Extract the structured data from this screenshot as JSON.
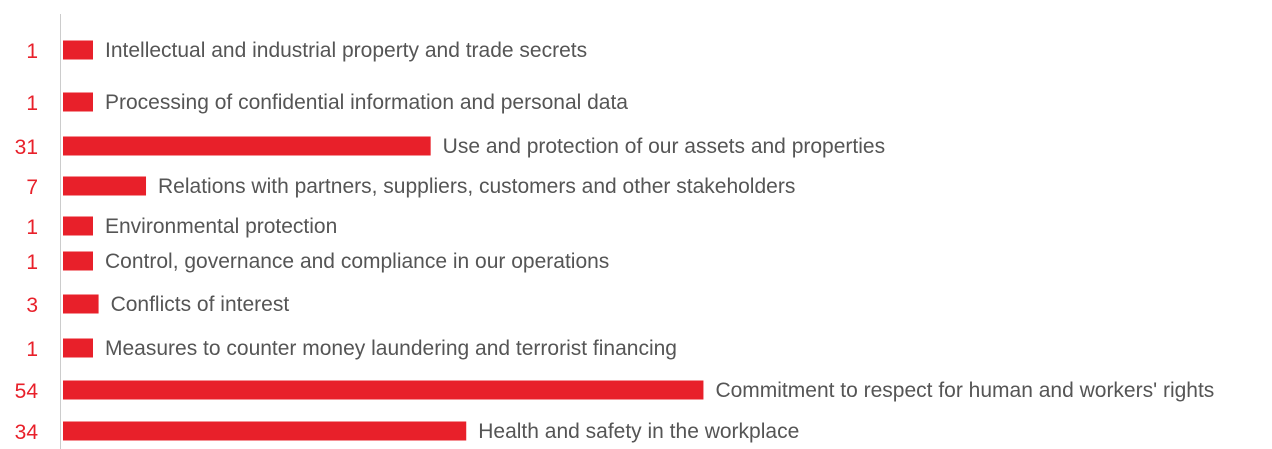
{
  "chart_data": {
    "type": "bar",
    "orientation": "horizontal",
    "categories": [
      "Intellectual and industrial property and trade secrets",
      "Processing of confidential information and personal data",
      "Use and protection of our assets and properties",
      "Relations with partners, suppliers, customers and other stakeholders",
      "Environmental protection",
      "Control, governance and compliance in our operations",
      "Conflicts of interest",
      "Measures to counter money laundering and terrorist financing",
      "Commitment to respect for human and workers' rights",
      "Health and safety in the workplace"
    ],
    "values": [
      1,
      1,
      31,
      7,
      1,
      1,
      3,
      1,
      54,
      34
    ],
    "value_labels": [
      "1",
      "1",
      "31",
      "7",
      "1",
      "1",
      "3",
      "1",
      "54",
      "34"
    ],
    "bar_color": "#e8202a",
    "value_label_color": "#e8202a",
    "category_label_color": "#555555",
    "axis_color": "#cccccc",
    "grid": false,
    "legend": "none"
  }
}
